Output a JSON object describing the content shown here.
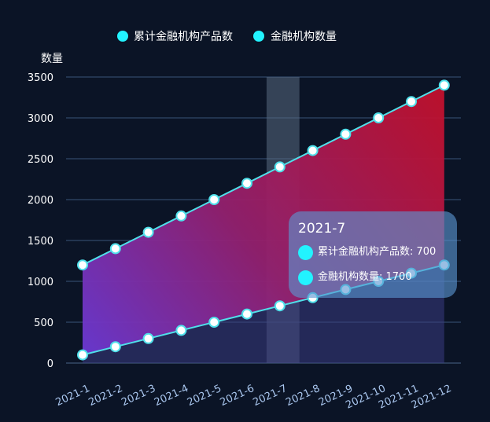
{
  "chart_data": {
    "type": "area",
    "categories": [
      "2021-1",
      "2021-2",
      "2021-3",
      "2021-4",
      "2021-5",
      "2021-6",
      "2021-7",
      "2021-8",
      "2021-9",
      "2021-10",
      "2021-11",
      "2021-12"
    ],
    "x_tick_labels": [
      "2021-1",
      "2021-2",
      "2021-3",
      "2021-4",
      "2021-5",
      "2021-6",
      "2021-7",
      "2021-8",
      "2021-9",
      "2021-10",
      "2021-11",
      "2021-12"
    ],
    "series": [
      {
        "name": "累计金融机构产品数",
        "values": [
          100,
          200,
          300,
          400,
          500,
          600,
          700,
          800,
          900,
          1000,
          1100,
          1200
        ]
      },
      {
        "name": "金融机构数量",
        "values": [
          1200,
          1400,
          1600,
          1800,
          2000,
          2200,
          2400,
          2600,
          2800,
          3000,
          3200,
          3400
        ]
      }
    ],
    "ylabel": "数量",
    "ylim": [
      0,
      3500
    ],
    "y_ticks": [
      0,
      500,
      1000,
      1500,
      2000,
      2500,
      3000,
      3500
    ],
    "grid": true,
    "legend_position": "top-center",
    "highlighted_category": "2021-6",
    "colors": {
      "background": "#0b1426",
      "line": "#4fe0ea",
      "legend_dot": "#22f3ff",
      "area_top_right": "#c4102a",
      "area_bottom_left": "#6a3ad8",
      "grid": "#3a5578",
      "axis_text": "#ffffff",
      "x_tick_text": "#a9c6ee"
    }
  },
  "tooltip": {
    "title": "2021-7",
    "rows": [
      "累计金融机构产品数: 700",
      "金融机构数量: 1700"
    ]
  }
}
